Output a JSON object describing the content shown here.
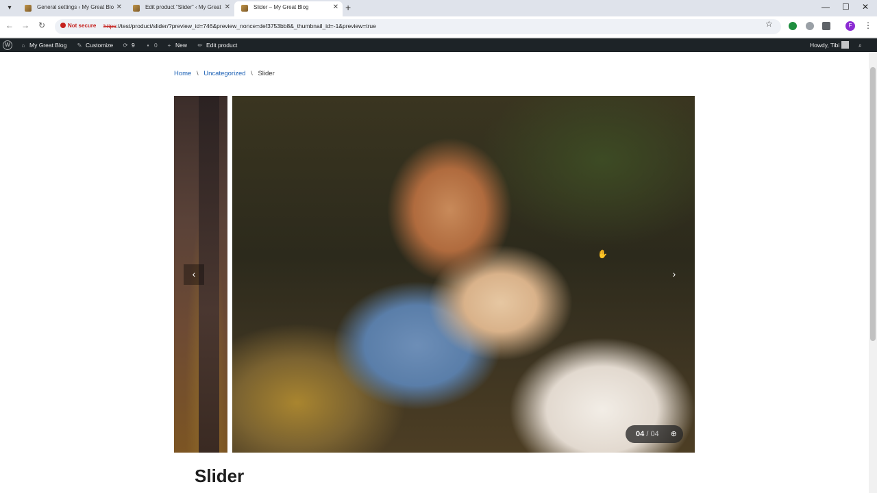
{
  "browser": {
    "tabs": [
      {
        "title": "General settings ‹ My Great Blo",
        "active": false
      },
      {
        "title": "Edit product “Slider” ‹ My Great",
        "active": false
      },
      {
        "title": "Slider – My Great Blog",
        "active": true
      }
    ],
    "new_tab": "+",
    "security_label": "Not secure",
    "url_scheme": "https",
    "url_rest": "://test/product/slider/?preview_id=746&preview_nonce=def3753bb8&_thumbnail_id=-1&preview=true",
    "profile_initial": "F"
  },
  "adminbar": {
    "site_name": "My Great Blog",
    "customize": "Customize",
    "updates_count": "9",
    "comments_count": "0",
    "new_label": "New",
    "edit_label": "Edit product",
    "greeting": "Howdy, Tibi"
  },
  "breadcrumb": {
    "home": "Home",
    "separator": "\\",
    "category": "Uncategorized",
    "current": "Slider"
  },
  "slider": {
    "current": "04",
    "separator": "/",
    "total": "04"
  },
  "product": {
    "title": "Slider"
  }
}
